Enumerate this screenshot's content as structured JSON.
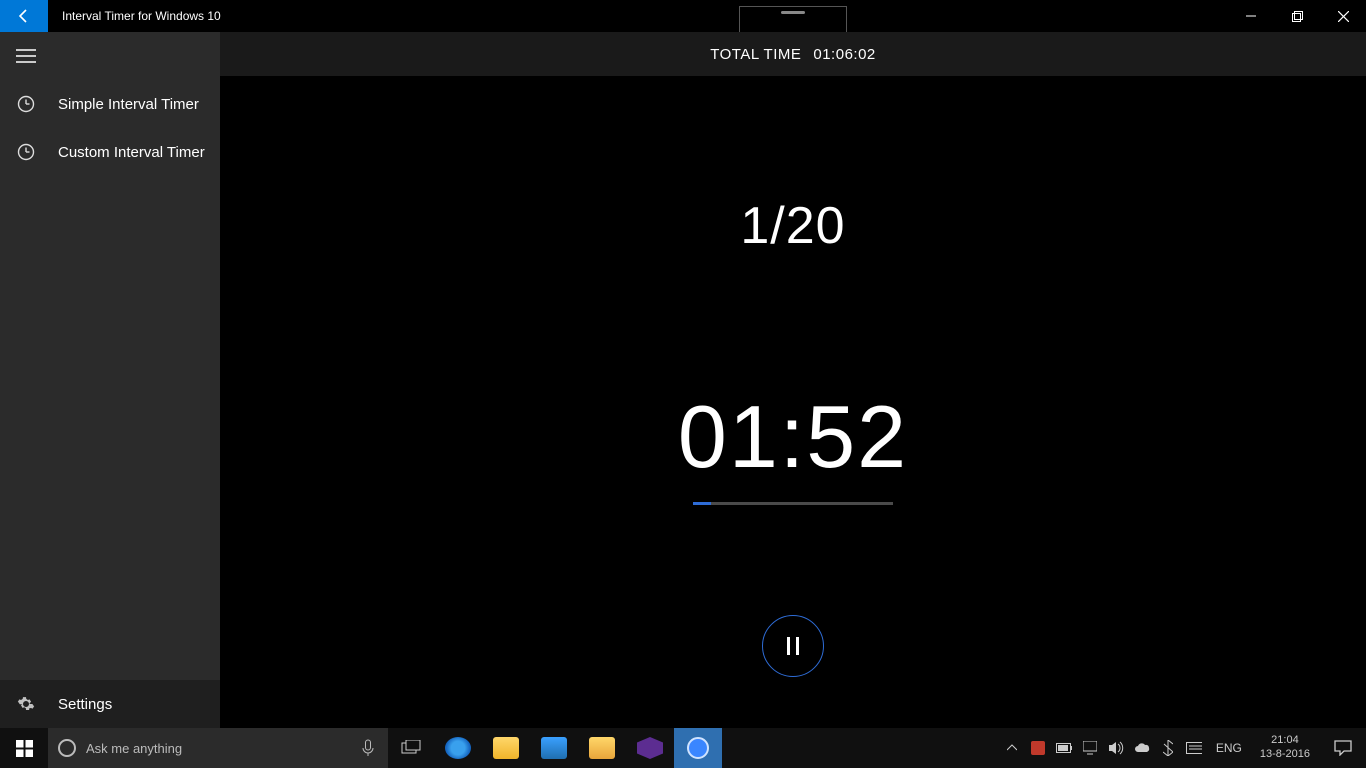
{
  "titlebar": {
    "title": "Interval Timer for Windows 10"
  },
  "sidebar": {
    "items": [
      {
        "label": "Simple Interval Timer"
      },
      {
        "label": "Custom Interval Timer"
      }
    ],
    "settings_label": "Settings"
  },
  "header": {
    "total_label": "TOTAL TIME",
    "total_value": "01:06:02"
  },
  "timer": {
    "round": "1/20",
    "current": "01:52"
  },
  "taskbar": {
    "search_placeholder": "Ask me anything",
    "lang": "ENG",
    "time": "21:04",
    "date": "13-8-2016"
  }
}
